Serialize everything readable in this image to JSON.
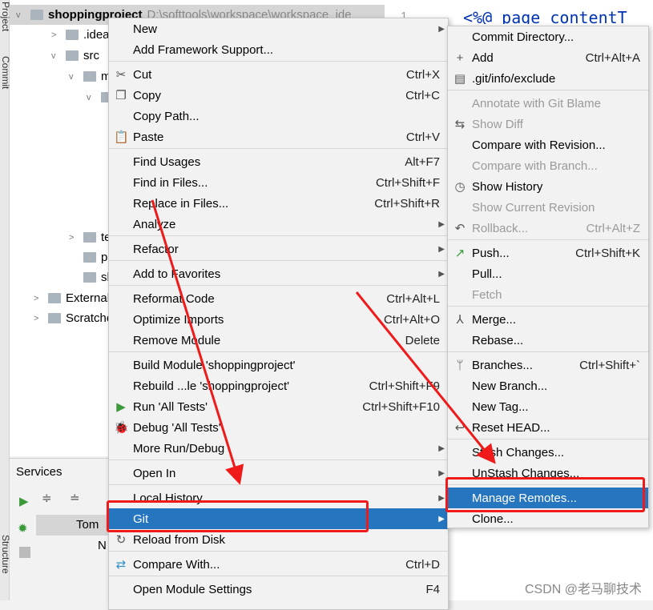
{
  "side_tabs": {
    "project": "Project",
    "commit": "Commit",
    "structure": "Structure"
  },
  "project_tree": {
    "root": {
      "name": "shoppingproject",
      "path": "D:\\softtools\\workspace\\workspace_ide"
    },
    "items": [
      {
        "label": ".idea",
        "depth": 1,
        "chev": ">"
      },
      {
        "label": "src",
        "depth": 1,
        "chev": "v"
      },
      {
        "label": "ma",
        "depth": 2,
        "chev": "v"
      },
      {
        "label": "",
        "depth": 3,
        "chev": "v"
      },
      {
        "label": "tes",
        "depth": 2,
        "chev": ">"
      },
      {
        "label": "pom.x",
        "depth": 2,
        "chev": ""
      },
      {
        "label": "shopp",
        "depth": 2,
        "chev": ""
      },
      {
        "label": "External L",
        "depth": 0,
        "chev": ">"
      },
      {
        "label": "Scratches",
        "depth": 0,
        "chev": ">"
      }
    ]
  },
  "editor": {
    "line_number": "1",
    "code": "<%@ page contentT"
  },
  "services": {
    "title": "Services",
    "tree_item": "Tom",
    "sub_item": "N"
  },
  "context_menu": [
    {
      "label": "New",
      "arrow": true
    },
    {
      "label": "Add Framework Support..."
    },
    {
      "sep": true
    },
    {
      "label": "Cut",
      "shortcut": "Ctrl+X",
      "icon": "scissors-icon",
      "glyph": "✂"
    },
    {
      "label": "Copy",
      "shortcut": "Ctrl+C",
      "icon": "copy-icon",
      "glyph": "❐"
    },
    {
      "label": "Copy Path..."
    },
    {
      "label": "Paste",
      "shortcut": "Ctrl+V",
      "icon": "paste-icon",
      "glyph": "📋"
    },
    {
      "sep": true
    },
    {
      "label": "Find Usages",
      "shortcut": "Alt+F7"
    },
    {
      "label": "Find in Files...",
      "shortcut": "Ctrl+Shift+F"
    },
    {
      "label": "Replace in Files...",
      "shortcut": "Ctrl+Shift+R"
    },
    {
      "label": "Analyze",
      "arrow": true
    },
    {
      "sep": true
    },
    {
      "label": "Refactor",
      "arrow": true
    },
    {
      "sep": true
    },
    {
      "label": "Add to Favorites",
      "arrow": true
    },
    {
      "sep": true
    },
    {
      "label": "Reformat Code",
      "shortcut": "Ctrl+Alt+L"
    },
    {
      "label": "Optimize Imports",
      "shortcut": "Ctrl+Alt+O"
    },
    {
      "label": "Remove Module",
      "shortcut": "Delete"
    },
    {
      "sep": true
    },
    {
      "label": "Build Module 'shoppingproject'"
    },
    {
      "label": "Rebuild ...le 'shoppingproject'",
      "shortcut": "Ctrl+Shift+F9"
    },
    {
      "label": "Run 'All Tests'",
      "shortcut": "Ctrl+Shift+F10",
      "icon": "run-icon",
      "glyph": "▶",
      "color": "#3a9a3a"
    },
    {
      "label": "Debug 'All Tests'",
      "icon": "debug-icon",
      "glyph": "🐞",
      "color": "#3a9a3a"
    },
    {
      "label": "More Run/Debug",
      "arrow": true
    },
    {
      "sep": true
    },
    {
      "label": "Open In",
      "arrow": true
    },
    {
      "sep": true
    },
    {
      "label": "Local History",
      "arrow": true
    },
    {
      "label": "Git",
      "arrow": true,
      "selected": true
    },
    {
      "label": "Reload from Disk",
      "icon": "reload-icon",
      "glyph": "↻"
    },
    {
      "sep": true
    },
    {
      "label": "Compare With...",
      "shortcut": "Ctrl+D",
      "icon": "compare-icon",
      "glyph": "⇄",
      "color": "#3592c4"
    },
    {
      "sep": true
    },
    {
      "label": "Open Module Settings",
      "shortcut": "F4"
    }
  ],
  "git_submenu": [
    {
      "label": "Commit Directory..."
    },
    {
      "label": "Add",
      "shortcut": "Ctrl+Alt+A",
      "icon": "plus-icon",
      "glyph": "+"
    },
    {
      "label": ".git/info/exclude",
      "icon": "file-ignore-icon",
      "glyph": "▤"
    },
    {
      "sep": true
    },
    {
      "label": "Annotate with Git Blame",
      "disabled": true
    },
    {
      "label": "Show Diff",
      "disabled": true,
      "icon": "diff-icon",
      "glyph": "⇆"
    },
    {
      "label": "Compare with Revision..."
    },
    {
      "label": "Compare with Branch...",
      "disabled": true
    },
    {
      "label": "Show History",
      "icon": "clock-icon",
      "glyph": "◷"
    },
    {
      "label": "Show Current Revision",
      "disabled": true
    },
    {
      "label": "Rollback...",
      "shortcut": "Ctrl+Alt+Z",
      "disabled": true,
      "icon": "rollback-icon",
      "glyph": "↶"
    },
    {
      "sep": true
    },
    {
      "label": "Push...",
      "shortcut": "Ctrl+Shift+K",
      "icon": "push-icon",
      "glyph": "↗",
      "color": "#3a9a3a"
    },
    {
      "label": "Pull..."
    },
    {
      "label": "Fetch",
      "disabled": true
    },
    {
      "sep": true
    },
    {
      "label": "Merge...",
      "icon": "merge-icon",
      "glyph": "⅄"
    },
    {
      "label": "Rebase..."
    },
    {
      "sep": true
    },
    {
      "label": "Branches...",
      "shortcut": "Ctrl+Shift+`",
      "icon": "branch-icon",
      "glyph": "ᛘ"
    },
    {
      "label": "New Branch..."
    },
    {
      "label": "New Tag..."
    },
    {
      "label": "Reset HEAD...",
      "icon": "reset-icon",
      "glyph": "↩"
    },
    {
      "sep": true
    },
    {
      "label": "Stash Changes..."
    },
    {
      "label": "UnStash Changes..."
    },
    {
      "sep": true
    },
    {
      "label": "Manage Remotes...",
      "selected": true
    },
    {
      "label": "Clone..."
    }
  ],
  "watermark": "CSDN @老马聊技术",
  "colors": {
    "selection": "#2675bf",
    "annotation": "#f01a1a",
    "menu_bg": "#f2f2f2"
  }
}
